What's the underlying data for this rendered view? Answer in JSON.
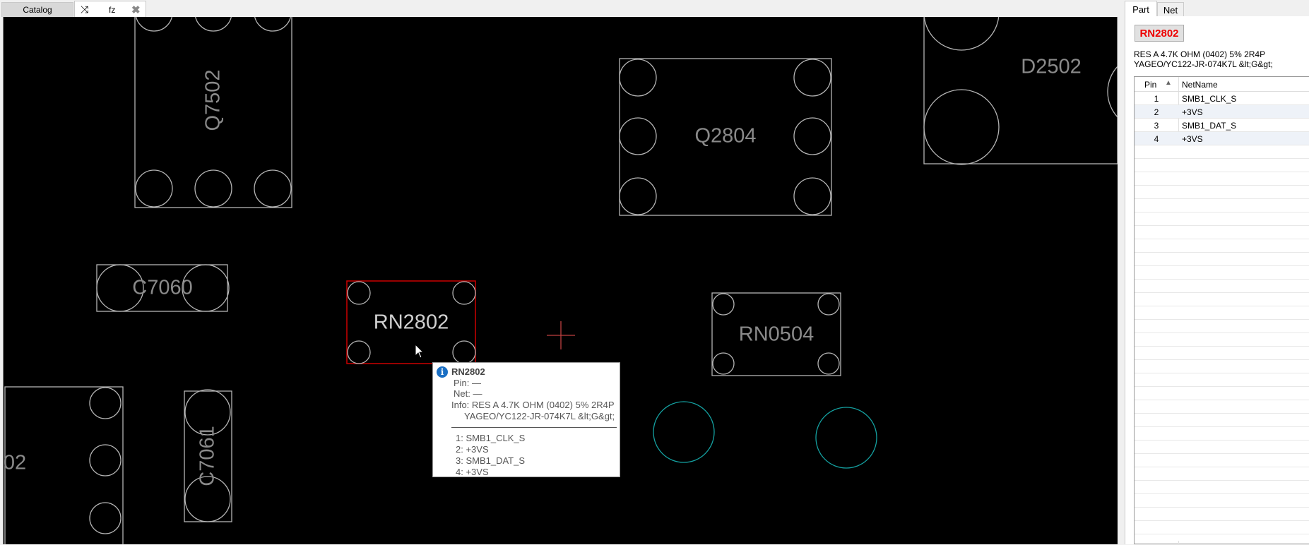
{
  "tabs": {
    "catalog": "Catalog",
    "fz": "fz"
  },
  "board": {
    "components": [
      "Q7502",
      "D2502",
      "Q2804",
      "C7060",
      "RN2802",
      "RN0504",
      "02",
      "C7061"
    ]
  },
  "tooltip": {
    "title": "RN2802",
    "pin": "Pin: —",
    "net": "Net: —",
    "info1": "Info: RES A 4.7K OHM (0402) 5% 2R4P",
    "info2": "YAGEO/YC122-JR-074K7L &lt;G&gt;",
    "pins": [
      "1: SMB1_CLK_S",
      "2: +3VS",
      "3: SMB1_DAT_S",
      "4: +3VS"
    ]
  },
  "panel": {
    "tabs": [
      "Part",
      "Net"
    ],
    "part_name": "RN2802",
    "desc1": "RES A 4.7K OHM (0402) 5% 2R4P",
    "desc2": "YAGEO/YC122-JR-074K7L &lt;G&gt;",
    "columns": [
      "Pin",
      "NetName"
    ],
    "rows": [
      {
        "pin": "1",
        "net": "SMB1_CLK_S"
      },
      {
        "pin": "2",
        "net": "+3VS"
      },
      {
        "pin": "3",
        "net": "SMB1_DAT_S"
      },
      {
        "pin": "4",
        "net": "+3VS"
      }
    ]
  },
  "colors": {
    "outline": "#b4b4b4",
    "selected": "#cc0000",
    "net_highlight": "#14a0a0",
    "part_label": "#e00000"
  }
}
